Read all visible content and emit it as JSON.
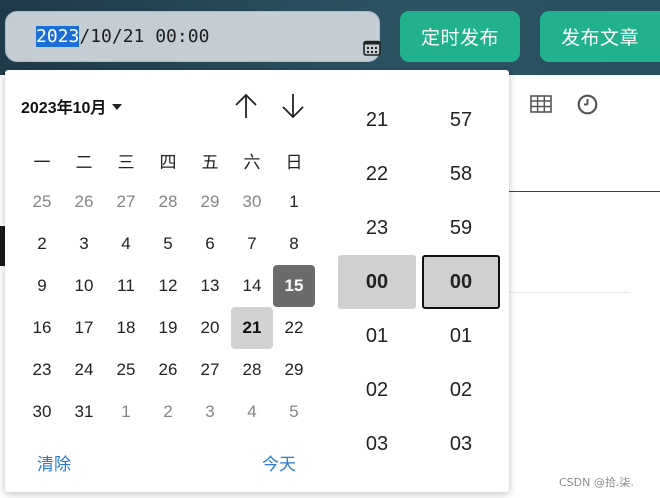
{
  "input": {
    "year_selected": "2023",
    "rest": "/10/21 00:00"
  },
  "buttons": {
    "schedule": "定时发布",
    "publish": "发布文章"
  },
  "calendar": {
    "month_title": "2023年10月",
    "weekdays": [
      "一",
      "二",
      "三",
      "四",
      "五",
      "六",
      "日"
    ],
    "weeks": [
      [
        {
          "d": "25",
          "m": true
        },
        {
          "d": "26",
          "m": true
        },
        {
          "d": "27",
          "m": true
        },
        {
          "d": "28",
          "m": true
        },
        {
          "d": "29",
          "m": true
        },
        {
          "d": "30",
          "m": true
        },
        {
          "d": "1"
        }
      ],
      [
        {
          "d": "2"
        },
        {
          "d": "3"
        },
        {
          "d": "4"
        },
        {
          "d": "5"
        },
        {
          "d": "6"
        },
        {
          "d": "7"
        },
        {
          "d": "8"
        }
      ],
      [
        {
          "d": "9"
        },
        {
          "d": "10"
        },
        {
          "d": "11"
        },
        {
          "d": "12"
        },
        {
          "d": "13"
        },
        {
          "d": "14"
        },
        {
          "d": "15",
          "state": "highlight"
        }
      ],
      [
        {
          "d": "16"
        },
        {
          "d": "17"
        },
        {
          "d": "18"
        },
        {
          "d": "19"
        },
        {
          "d": "20"
        },
        {
          "d": "21",
          "state": "today"
        },
        {
          "d": "22"
        }
      ],
      [
        {
          "d": "23"
        },
        {
          "d": "24"
        },
        {
          "d": "25"
        },
        {
          "d": "26"
        },
        {
          "d": "27"
        },
        {
          "d": "28"
        },
        {
          "d": "29"
        }
      ],
      [
        {
          "d": "30"
        },
        {
          "d": "31"
        },
        {
          "d": "1",
          "m": true
        },
        {
          "d": "2",
          "m": true
        },
        {
          "d": "3",
          "m": true
        },
        {
          "d": "4",
          "m": true
        },
        {
          "d": "5",
          "m": true
        }
      ]
    ],
    "clear_label": "清除",
    "today_label": "今天"
  },
  "time": {
    "hours": [
      "21",
      "22",
      "23",
      "00",
      "01",
      "02",
      "03"
    ],
    "minutes": [
      "57",
      "58",
      "59",
      "00",
      "01",
      "02",
      "03"
    ],
    "selected_index": 3
  },
  "watermark": "CSDN @拾.柒."
}
